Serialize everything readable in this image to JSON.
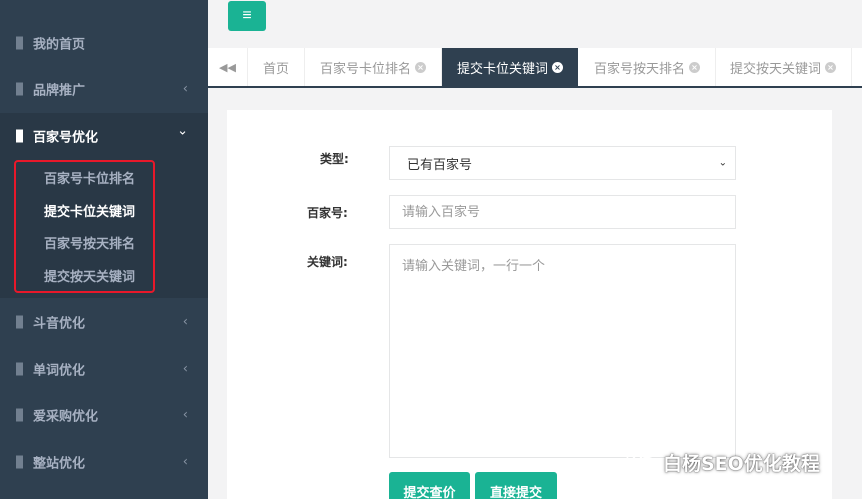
{
  "sidebar": {
    "items": [
      {
        "label": "我的首页"
      },
      {
        "label": "品牌推广",
        "chevron": "‹"
      },
      {
        "label": "百家号优化",
        "chevron": "⌄"
      },
      {
        "label": "斗音优化",
        "chevron": "‹"
      },
      {
        "label": "单词优化",
        "chevron": "‹"
      },
      {
        "label": "爱采购优化",
        "chevron": "‹"
      },
      {
        "label": "整站优化",
        "chevron": "‹"
      }
    ],
    "submenu": [
      {
        "label": "百家号卡位排名"
      },
      {
        "label": "提交卡位关键词"
      },
      {
        "label": "百家号按天排名"
      },
      {
        "label": "提交按天关键词"
      }
    ]
  },
  "topbar": {
    "menu_icon": "≡"
  },
  "tabs": {
    "back_icon": "◀◀",
    "items": [
      {
        "label": "首页"
      },
      {
        "label": "百家号卡位排名",
        "close": "×"
      },
      {
        "label": "提交卡位关键词",
        "close": "×"
      },
      {
        "label": "百家号按天排名",
        "close": "×"
      },
      {
        "label": "提交按天关键词",
        "close": "×"
      }
    ]
  },
  "form": {
    "type_label": "类型:",
    "type_value": "已有百家号",
    "type_caret": "⌄",
    "account_label": "百家号:",
    "account_placeholder": "请输入百家号",
    "keywords_label": "关键词:",
    "keywords_placeholder": "请输入关键词，一行一个",
    "query_button": "提交查价",
    "direct_button": "直接提交"
  },
  "watermark": {
    "text": "白杨SEO优化教程"
  },
  "colors": {
    "sidebar_bg": "#2f4050",
    "accent_green": "#1ab394",
    "highlight_red": "#e8182a"
  }
}
